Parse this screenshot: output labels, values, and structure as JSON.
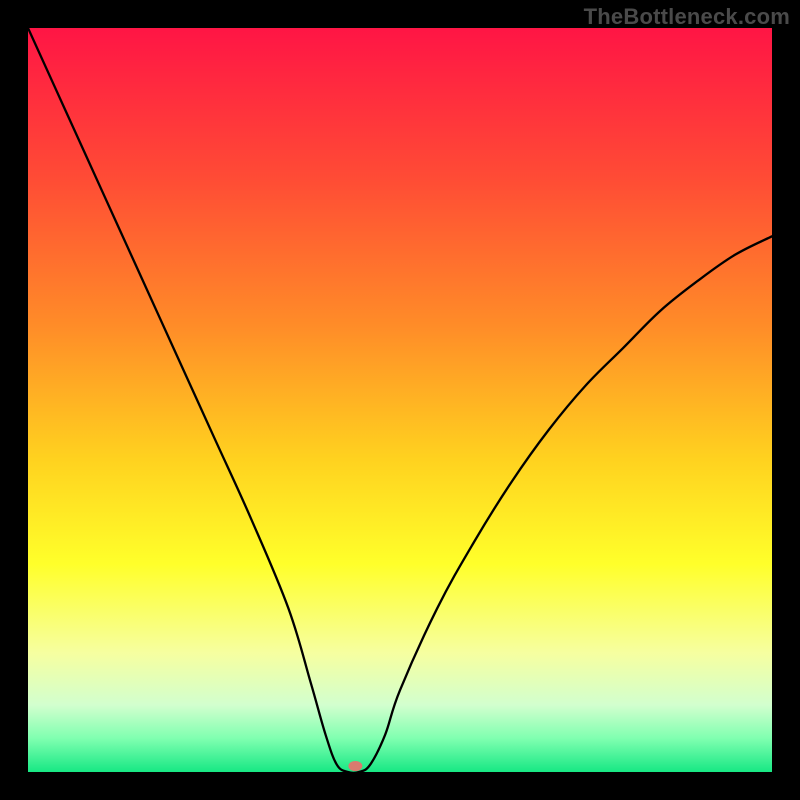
{
  "watermark": {
    "text": "TheBottleneck.com"
  },
  "chart_data": {
    "type": "line",
    "title": "",
    "xlabel": "",
    "ylabel": "",
    "xlim": [
      0,
      100
    ],
    "ylim": [
      0,
      100
    ],
    "gradient_stops": [
      {
        "offset": 0.0,
        "color": "#ff1545"
      },
      {
        "offset": 0.2,
        "color": "#ff4b35"
      },
      {
        "offset": 0.4,
        "color": "#ff8c28"
      },
      {
        "offset": 0.58,
        "color": "#ffd21f"
      },
      {
        "offset": 0.72,
        "color": "#ffff2a"
      },
      {
        "offset": 0.84,
        "color": "#f6ffa0"
      },
      {
        "offset": 0.91,
        "color": "#d2ffce"
      },
      {
        "offset": 0.955,
        "color": "#7fffb0"
      },
      {
        "offset": 1.0,
        "color": "#17e884"
      }
    ],
    "series": [
      {
        "name": "bottleneck-curve",
        "x": [
          0.0,
          5,
          10,
          15,
          20,
          25,
          30,
          35,
          38,
          40,
          41.5,
          43,
          44.5,
          46,
          48,
          50,
          55,
          60,
          65,
          70,
          75,
          80,
          85,
          90,
          95,
          100
        ],
        "y": [
          100,
          89,
          78,
          67,
          56,
          45,
          34,
          22,
          12,
          5,
          1,
          0,
          0,
          1,
          5,
          11,
          22,
          31,
          39,
          46,
          52,
          57,
          62,
          66,
          69.5,
          72
        ]
      }
    ],
    "flat_bottom": {
      "x_start": 41.5,
      "x_end": 44.5,
      "y": 0
    },
    "marker": {
      "x": 44,
      "y": 0.8,
      "color": "#d97b6f",
      "rx": 7,
      "ry": 5
    }
  }
}
